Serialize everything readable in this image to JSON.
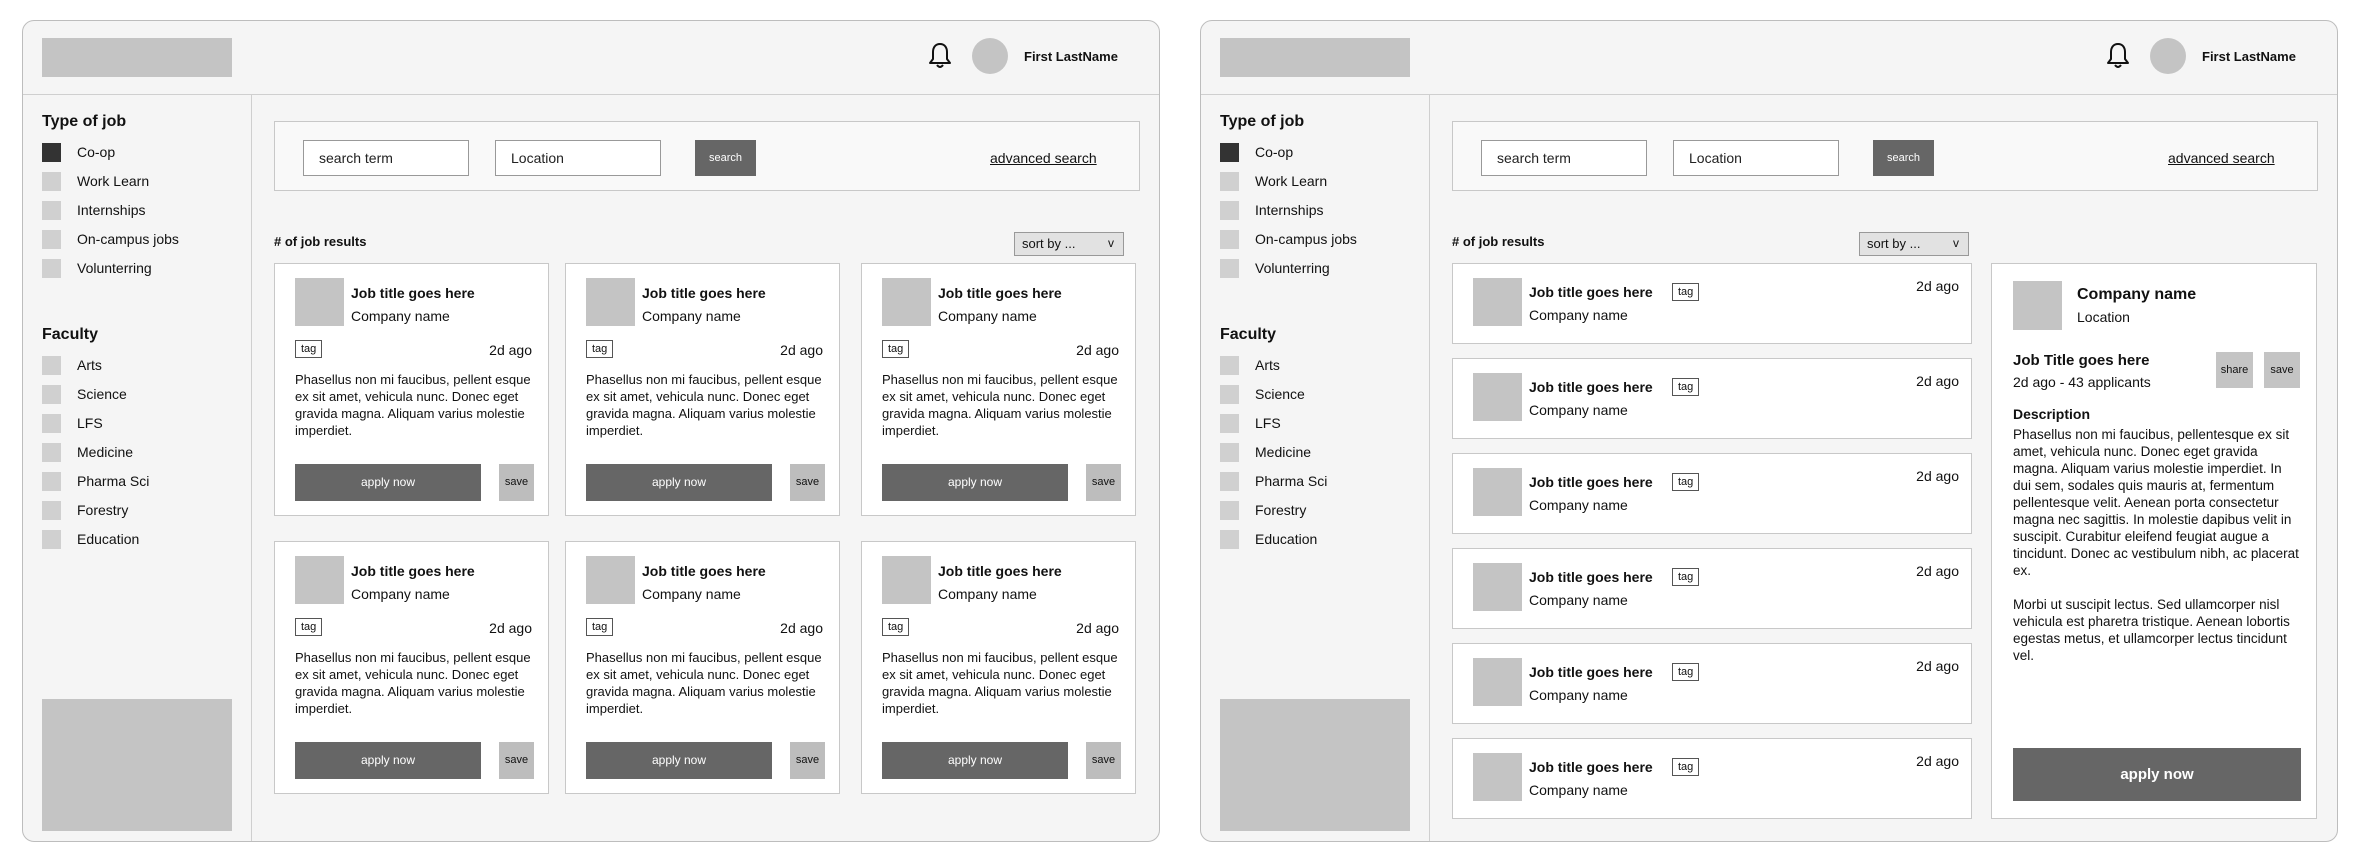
{
  "user": {
    "name": "First LastName"
  },
  "sidebar": {
    "type_heading": "Type of job",
    "types": [
      {
        "label": "Co-op",
        "checked": true
      },
      {
        "label": "Work Learn",
        "checked": false
      },
      {
        "label": "Internships",
        "checked": false
      },
      {
        "label": "On-campus jobs",
        "checked": false
      },
      {
        "label": "Volunterring",
        "checked": false
      }
    ],
    "faculty_heading": "Faculty",
    "faculties": [
      {
        "label": "Arts"
      },
      {
        "label": "Science"
      },
      {
        "label": "LFS"
      },
      {
        "label": "Medicine"
      },
      {
        "label": "Pharma Sci"
      },
      {
        "label": "Forestry"
      },
      {
        "label": "Education"
      }
    ]
  },
  "search": {
    "term_placeholder": "search term",
    "location_placeholder": "Location",
    "button": "search",
    "advanced": "advanced search"
  },
  "results": {
    "count_label": "# of job results",
    "sort_label": "sort by ...",
    "sort_chevron": "v"
  },
  "job": {
    "title": "Job title goes here",
    "company": "Company name",
    "tag": "tag",
    "posted": "2d ago",
    "description": "Phasellus non mi faucibus, pellent esque ex sit amet, vehicula nunc. Donec eget gravida magna. Aliquam varius molestie imperdiet.",
    "apply": "apply now",
    "save": "save"
  },
  "detail": {
    "company": "Company name",
    "location": "Location",
    "job_title": "Job Title goes here",
    "meta": "2d ago - 43 applicants",
    "share": "share",
    "save": "save",
    "desc_heading": "Description",
    "desc_p1": "Phasellus non mi faucibus, pellentesque ex sit amet, vehicula nunc. Donec eget gravida magna. Aliquam varius molestie imperdiet. In dui sem, sodales quis mauris at, fermentum pellentesque velit. Aenean porta consectetur magna nec sagittis. In molestie dapibus velit in suscipit. Curabitur eleifend feugiat augue a tincidunt. Donec ac vestibulum nibh, ac placerat ex.",
    "desc_p2": "Morbi ut suscipit lectus. Sed ullamcorper nisl vehicula est pharetra tristique. Aenean lobortis egestas metus, et ullamcorper lectus tincidunt vel.",
    "apply": "apply now"
  },
  "colors": {
    "frame_bg": "#f5f5f5",
    "button_dark": "#666666",
    "placeholder_gray": "#c4c4c4",
    "checked_box": "#333333"
  }
}
